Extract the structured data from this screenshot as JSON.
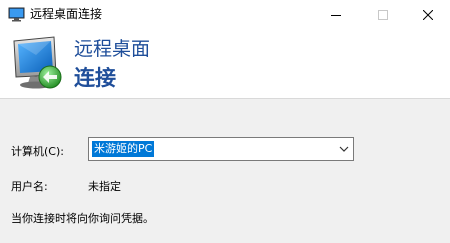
{
  "window": {
    "title": "远程桌面连接",
    "icons": {
      "app": "remote-desktop-icon",
      "minimize": "minimize-icon",
      "maximize": "maximize-icon",
      "close": "close-icon"
    }
  },
  "banner": {
    "line1": "远程桌面",
    "line2": "连接",
    "icon": "remote-desktop-monitor-icon",
    "title_color": "#1f4e9a"
  },
  "form": {
    "computer_label": "计算机(C):",
    "computer_value": "米游姬的PC",
    "dropdown_icon": "chevron-down-icon",
    "user_label": "用户名:",
    "user_value": "未指定",
    "hint": "当你连接时将向你询问凭据。"
  },
  "colors": {
    "selection": "#0078d7",
    "window_background": "#f0f0f0"
  }
}
